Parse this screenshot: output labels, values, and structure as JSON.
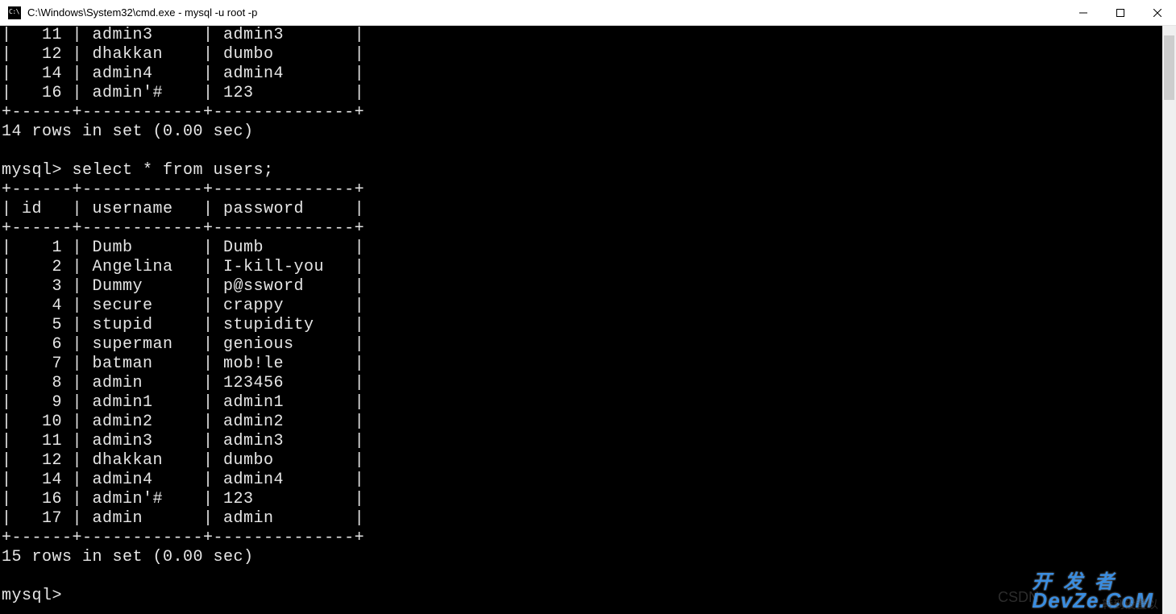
{
  "window": {
    "title": "C:\\Windows\\System32\\cmd.exe - mysql  -u root -p"
  },
  "terminal": {
    "top_rows": [
      {
        "id": "11",
        "username": "admin3",
        "password": "admin3"
      },
      {
        "id": "12",
        "username": "dhakkan",
        "password": "dumbo"
      },
      {
        "id": "14",
        "username": "admin4",
        "password": "admin4"
      },
      {
        "id": "16",
        "username": "admin'#",
        "password": "123"
      }
    ],
    "top_summary": "14 rows in set (0.00 sec)",
    "prompt1": "mysql> ",
    "query": "select * from users;",
    "columns": [
      "id",
      "username",
      "password"
    ],
    "rows": [
      {
        "id": "1",
        "username": "Dumb",
        "password": "Dumb"
      },
      {
        "id": "2",
        "username": "Angelina",
        "password": "I-kill-you"
      },
      {
        "id": "3",
        "username": "Dummy",
        "password": "p@ssword"
      },
      {
        "id": "4",
        "username": "secure",
        "password": "crappy"
      },
      {
        "id": "5",
        "username": "stupid",
        "password": "stupidity"
      },
      {
        "id": "6",
        "username": "superman",
        "password": "genious"
      },
      {
        "id": "7",
        "username": "batman",
        "password": "mob!le"
      },
      {
        "id": "8",
        "username": "admin",
        "password": "123456"
      },
      {
        "id": "9",
        "username": "admin1",
        "password": "admin1"
      },
      {
        "id": "10",
        "username": "admin2",
        "password": "admin2"
      },
      {
        "id": "11",
        "username": "admin3",
        "password": "admin3"
      },
      {
        "id": "12",
        "username": "dhakkan",
        "password": "dumbo"
      },
      {
        "id": "14",
        "username": "admin4",
        "password": "admin4"
      },
      {
        "id": "16",
        "username": "admin'#",
        "password": "123"
      },
      {
        "id": "17",
        "username": "admin",
        "password": "admin"
      }
    ],
    "bottom_summary": "15 rows in set (0.00 sec)",
    "prompt2": "mysql> "
  },
  "watermarks": {
    "csdn": "CSDN",
    "devze_top": "开 发 者",
    "devze_bot": "DevZe.CoM",
    "cn_extra": "转到设置以"
  }
}
